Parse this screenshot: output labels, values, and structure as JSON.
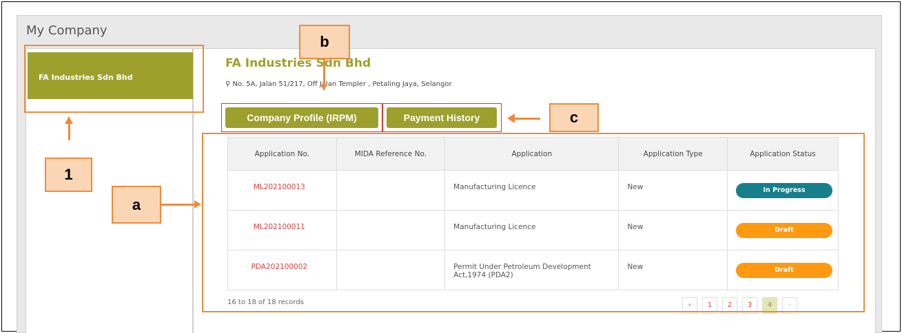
{
  "panel": {
    "title": "My Company"
  },
  "sidebar": {
    "company_tab": "FA Industries Sdn Bhd"
  },
  "company": {
    "name": "FA Industries Sdn Bhd",
    "address": "No. 5A, Jalan 51/217, Off Jalan Templer , Petaling Jaya, Selangor"
  },
  "buttons": {
    "profile": "Company Profile (IRPM)",
    "payment": "Payment History"
  },
  "table": {
    "headers": [
      "Application No.",
      "MIDA Reference No.",
      "Application",
      "Application Type",
      "Application Status"
    ],
    "rows": [
      {
        "app_no": "ML202100013",
        "mida_ref": "",
        "application": "Manufacturing Licence",
        "type": "New",
        "status": "In Progress"
      },
      {
        "app_no": "ML202100011",
        "mida_ref": "",
        "application": "Manufacturing Licence",
        "type": "New",
        "status": "Draft"
      },
      {
        "app_no": "PDA202100002",
        "mida_ref": "",
        "application": "Permit Under Petroleum Development Act,1974 (PDA2)",
        "type": "New",
        "status": "Draft"
      }
    ]
  },
  "footer": {
    "records": "16 to 18 of 18 records"
  },
  "pagination": {
    "prev": "‹",
    "pages": [
      "1",
      "2",
      "3",
      "4"
    ],
    "next": "›",
    "current": "4"
  },
  "annotations": {
    "one": "1",
    "a": "a",
    "b": "b",
    "c": "c"
  },
  "colors": {
    "accent": "#9ea02c",
    "in_progress": "#177f8c",
    "draft": "#ff9910",
    "annotation": "#ef8a3a",
    "link": "#e0413c"
  }
}
